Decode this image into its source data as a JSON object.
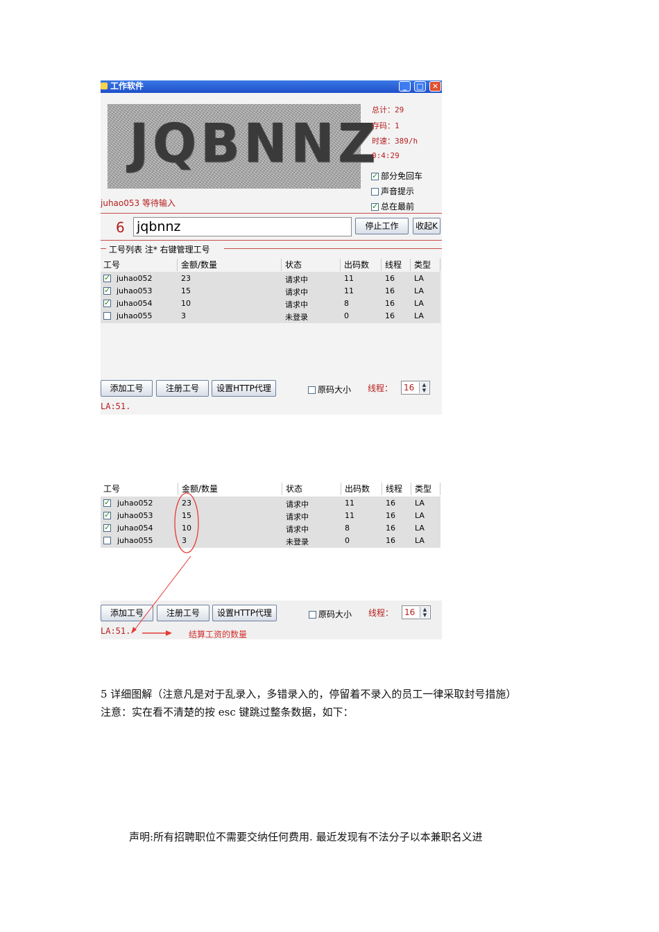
{
  "window": {
    "title": "工作软件",
    "captcha_text": "JQBNNZ",
    "stats": [
      "总计：29",
      "存码：1",
      "时速：389/h",
      "0:4:29"
    ],
    "options": [
      {
        "label": "部分免回车",
        "checked": true
      },
      {
        "label": "声音提示",
        "checked": false
      },
      {
        "label": "总在最前",
        "checked": true
      }
    ],
    "waiting": "juhao053 等待输入",
    "count": "6",
    "input_value": "jqbnnz",
    "stop_button": "停止工作",
    "collapse_button": "收起K",
    "group_label": "工号列表 注* 右键管理工号"
  },
  "table": {
    "headers": [
      "工号",
      "金额/数量",
      "状态",
      "出码数",
      "线程",
      "类型"
    ],
    "rows": [
      {
        "checked": true,
        "id": "juhao052",
        "amount": "23",
        "status": "请求中",
        "codes": "11",
        "threads": "16",
        "type": "LA"
      },
      {
        "checked": true,
        "id": "juhao053",
        "amount": "15",
        "status": "请求中",
        "codes": "11",
        "threads": "16",
        "type": "LA"
      },
      {
        "checked": true,
        "id": "juhao054",
        "amount": "10",
        "status": "请求中",
        "codes": "8",
        "threads": "16",
        "type": "LA"
      },
      {
        "checked": false,
        "id": "juhao055",
        "amount": "3",
        "status": "未登录",
        "codes": "0",
        "threads": "16",
        "type": "LA"
      }
    ]
  },
  "toolbar": {
    "add_button": "添加工号",
    "register_button": "注册工号",
    "proxy_button": "设置HTTP代理",
    "original_size": "原码大小",
    "threads_label": "线程：",
    "threads_value": "16",
    "status": "LA:51."
  },
  "annotation": "结算工资的数量",
  "text": {
    "line1": "5 详细图解（注意凡是对于乱录入，多错录入的，停留着不录入的员工一律采取封号措施）",
    "line2": "注意：实在看不清楚的按 esc 键跳过整条数据，如下：",
    "notice": "声明:所有招聘职位不需要交纳任何费用. 最近发现有不法分子以本兼职名义进"
  },
  "colors": {
    "accent_red": "#b71c1c",
    "titlebar": "#1f4fc9"
  }
}
